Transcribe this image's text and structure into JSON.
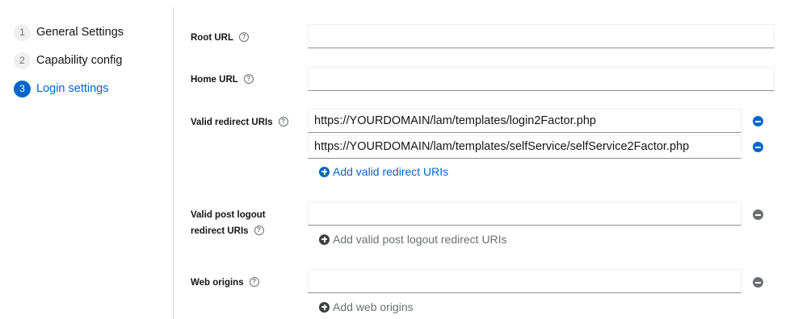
{
  "wizard": {
    "steps": [
      {
        "number": "1",
        "label": "General Settings"
      },
      {
        "number": "2",
        "label": "Capability config"
      },
      {
        "number": "3",
        "label": "Login settings"
      }
    ]
  },
  "form": {
    "root_url": {
      "label": "Root URL",
      "value": ""
    },
    "home_url": {
      "label": "Home URL",
      "value": ""
    },
    "valid_redirect_uris": {
      "label": "Valid redirect URIs",
      "values": [
        "https://YOURDOMAIN/lam/templates/login2Factor.php",
        "https://YOURDOMAIN/lam/templates/selfService/selfService2Factor.php"
      ],
      "add_label": "Add valid redirect URIs"
    },
    "valid_post_logout_redirect_uris": {
      "label_line1": "Valid post logout",
      "label_line2": "redirect URIs",
      "value": "",
      "add_label": "Add valid post logout redirect URIs"
    },
    "web_origins": {
      "label": "Web origins",
      "value": "",
      "add_label": "Add web origins"
    },
    "help_glyph": "?"
  },
  "colors": {
    "accent": "#0066cc",
    "muted": "#6a6e73",
    "border": "#d2d2d2"
  }
}
